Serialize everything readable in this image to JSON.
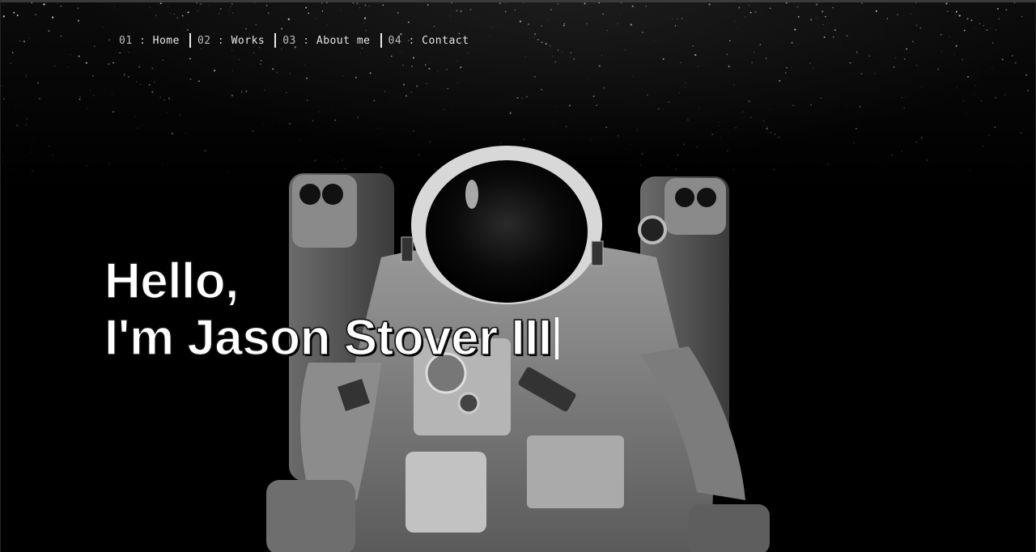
{
  "nav": {
    "items": [
      {
        "num": "01",
        "sep": " : ",
        "label": "Home"
      },
      {
        "num": "02",
        "sep": " : ",
        "label": "Works"
      },
      {
        "num": "03",
        "sep": " : ",
        "label": "About me"
      },
      {
        "num": "04",
        "sep": " : ",
        "label": "Contact"
      }
    ]
  },
  "hero": {
    "greeting": "Hello,",
    "name_line": "I'm Jason Stover III",
    "image": "astronaut-photo"
  },
  "colors": {
    "background": "#000000",
    "text": "#ffffff",
    "nav_text": "#e6e6e6"
  }
}
